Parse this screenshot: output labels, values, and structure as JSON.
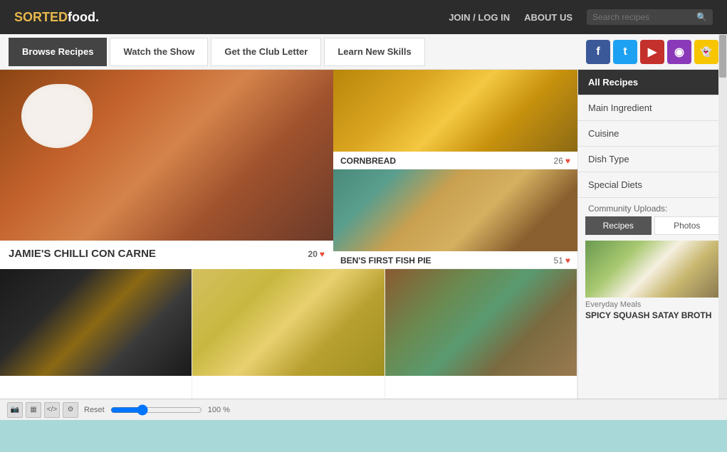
{
  "header": {
    "logo_text": "SORTED",
    "logo_suffix": "food.",
    "nav": {
      "join_login": "JOIN / LOG IN",
      "about_us": "ABOUT US"
    },
    "search_placeholder": "Search recipes"
  },
  "navbar": {
    "items": [
      {
        "label": "Browse Recipes",
        "active": true
      },
      {
        "label": "Watch the Show",
        "active": false
      },
      {
        "label": "Get the Club Letter",
        "active": false
      },
      {
        "label": "Learn New Skills",
        "active": false
      }
    ]
  },
  "social": {
    "icons": [
      {
        "name": "facebook",
        "color": "#3b5998",
        "symbol": "f"
      },
      {
        "name": "twitter",
        "color": "#1da1f2",
        "symbol": "t"
      },
      {
        "name": "youtube",
        "color": "#c4302b",
        "symbol": "▶"
      },
      {
        "name": "instagram",
        "color": "#8a3ab9",
        "symbol": "◉"
      },
      {
        "name": "snapchat",
        "color": "#f7c600",
        "symbol": "👻"
      }
    ]
  },
  "recipes": {
    "featured": {
      "title": "JAMIE'S CHILLI CON CARNE",
      "likes": "20"
    },
    "cornbread": {
      "title": "CORNBREAD",
      "likes": "26"
    },
    "fishpie": {
      "title": "BEN'S FIRST FISH PIE",
      "likes": "51"
    }
  },
  "sidebar": {
    "menu": [
      {
        "label": "All Recipes",
        "active": true
      },
      {
        "label": "Main Ingredient",
        "active": false
      },
      {
        "label": "Cuisine",
        "active": false
      },
      {
        "label": "Dish Type",
        "active": false
      },
      {
        "label": "Special Diets",
        "active": false
      }
    ],
    "community_label": "Community Uploads:",
    "community_tabs": [
      "Recipes",
      "Photos"
    ],
    "community_card": {
      "category": "Everyday Meals",
      "title": "SPICY SQUASH SATAY BROTH"
    }
  },
  "toolbar": {
    "reset_label": "Reset",
    "zoom": "100 %"
  }
}
